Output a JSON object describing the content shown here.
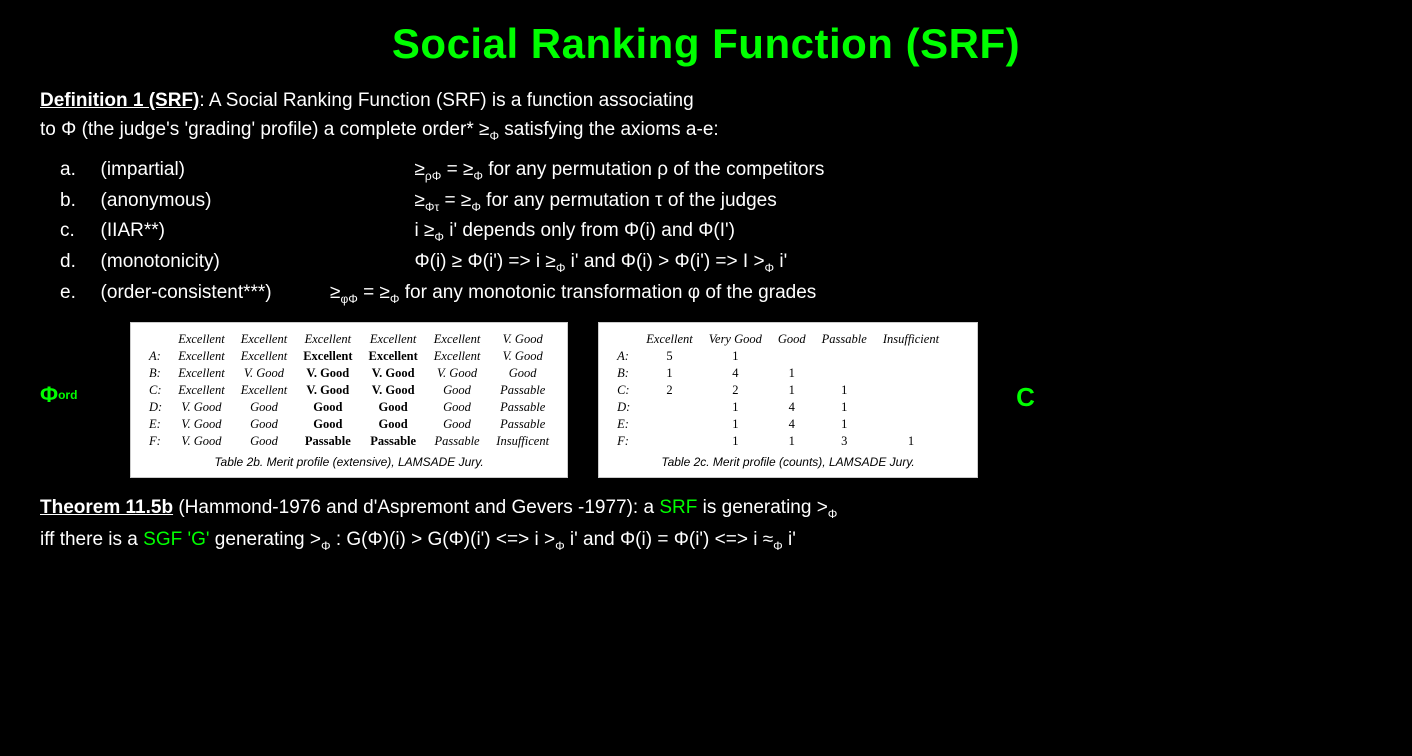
{
  "title": "Social Ranking Function (SRF)",
  "definition": {
    "label": "Definition 1 (SRF)",
    "text1": ": A Social Ranking Function (SRF) is a function associating",
    "text2": "to Φ (the judge's 'grading' profile) a complete order* ≥",
    "text2_sub": "Φ",
    "text2_end": " satisfying the axioms a-e:"
  },
  "axioms": [
    {
      "letter": "a.",
      "name": "(impartial)",
      "formula": "≥ρΦ = ≥Φ for any permutation ρ of the competitors"
    },
    {
      "letter": "b.",
      "name": "(anonymous)",
      "formula": "≥Φτ = ≥Φ for any permutation τ of the judges"
    },
    {
      "letter": "c.",
      "name": "(IIAR**)",
      "formula": "i ≥Φ i' depends only from Φ(i) and Φ(I')"
    },
    {
      "letter": "d.",
      "name": "(monotonicity)",
      "formula": "Φ(i) ≥ Φ(i') => i ≥Φ i' and Φ(i) > Φ(i') => I >Φ i'"
    },
    {
      "letter": "e.",
      "name": "(order-consistent***)",
      "formula": "≥φΦ = ≥Φ for any monotonic transformation φ of the grades"
    }
  ],
  "phi_ord_label": "Φord",
  "c_label": "C",
  "table2b": {
    "caption": "Table 2b. Merit profile (extensive), LAMSADE Jury.",
    "headers": [
      "",
      "Excellent",
      "Excellent",
      "Excellent",
      "Excellent",
      "Excellent",
      "V. Good"
    ],
    "rows": [
      {
        "id": "A:",
        "cols": [
          "Excellent",
          "Excellent",
          "Excellent",
          "Excellent",
          "Excellent",
          "V. Good"
        ],
        "bolds": [
          2,
          3
        ]
      },
      {
        "id": "B:",
        "cols": [
          "Excellent",
          "V. Good",
          "V. Good",
          "V. Good",
          "V. Good",
          "Good"
        ],
        "bolds": [
          2,
          3
        ]
      },
      {
        "id": "C:",
        "cols": [
          "Excellent",
          "Excellent",
          "V. Good",
          "V. Good",
          "Good",
          "Passable"
        ],
        "bolds": [
          2,
          3
        ]
      },
      {
        "id": "D:",
        "cols": [
          "V. Good",
          "Good",
          "Good",
          "Good",
          "Good",
          "Passable"
        ],
        "bolds": [
          2,
          3
        ]
      },
      {
        "id": "E:",
        "cols": [
          "V. Good",
          "Good",
          "Good",
          "Good",
          "Good",
          "Passable"
        ],
        "bolds": [
          2,
          3
        ]
      },
      {
        "id": "F:",
        "cols": [
          "V. Good",
          "Good",
          "Passable",
          "Passable",
          "Passable",
          "Insufficent"
        ],
        "bolds": [
          2,
          3
        ]
      }
    ]
  },
  "table2c": {
    "caption": "Table 2c. Merit profile (counts), LAMSADE Jury.",
    "headers": [
      "",
      "Excellent",
      "Very Good",
      "Good",
      "Passable",
      "Insufficient"
    ],
    "rows": [
      {
        "id": "A:",
        "cols": [
          "5",
          "1",
          "",
          "",
          ""
        ]
      },
      {
        "id": "B:",
        "cols": [
          "1",
          "4",
          "1",
          "",
          ""
        ]
      },
      {
        "id": "C:",
        "cols": [
          "2",
          "2",
          "1",
          "1",
          ""
        ]
      },
      {
        "id": "D:",
        "cols": [
          "",
          "1",
          "4",
          "1",
          ""
        ]
      },
      {
        "id": "E:",
        "cols": [
          "",
          "1",
          "4",
          "1",
          ""
        ]
      },
      {
        "id": "F:",
        "cols": [
          "",
          "1",
          "1",
          "3",
          "1"
        ]
      }
    ]
  },
  "theorem": {
    "label": "Theorem 11.5b",
    "text1": " (Hammond-1976 and d'Aspremont and Gevers -1977): a ",
    "srf": "SRF",
    "text2": " is generating >",
    "sub2": "Φ",
    "text3": " iff there is a ",
    "sgf": "SGF 'G'",
    "text4": " generating >",
    "sub4": "Φ",
    "text5": " :  G(Φ)(i) >  G(Φ)(i') <=> i >",
    "sub5": "Φ",
    "text6": " i' and  Φ(i) = Φ(i') <=> i ≈",
    "sub6": "Φ",
    "text7": " i'"
  }
}
